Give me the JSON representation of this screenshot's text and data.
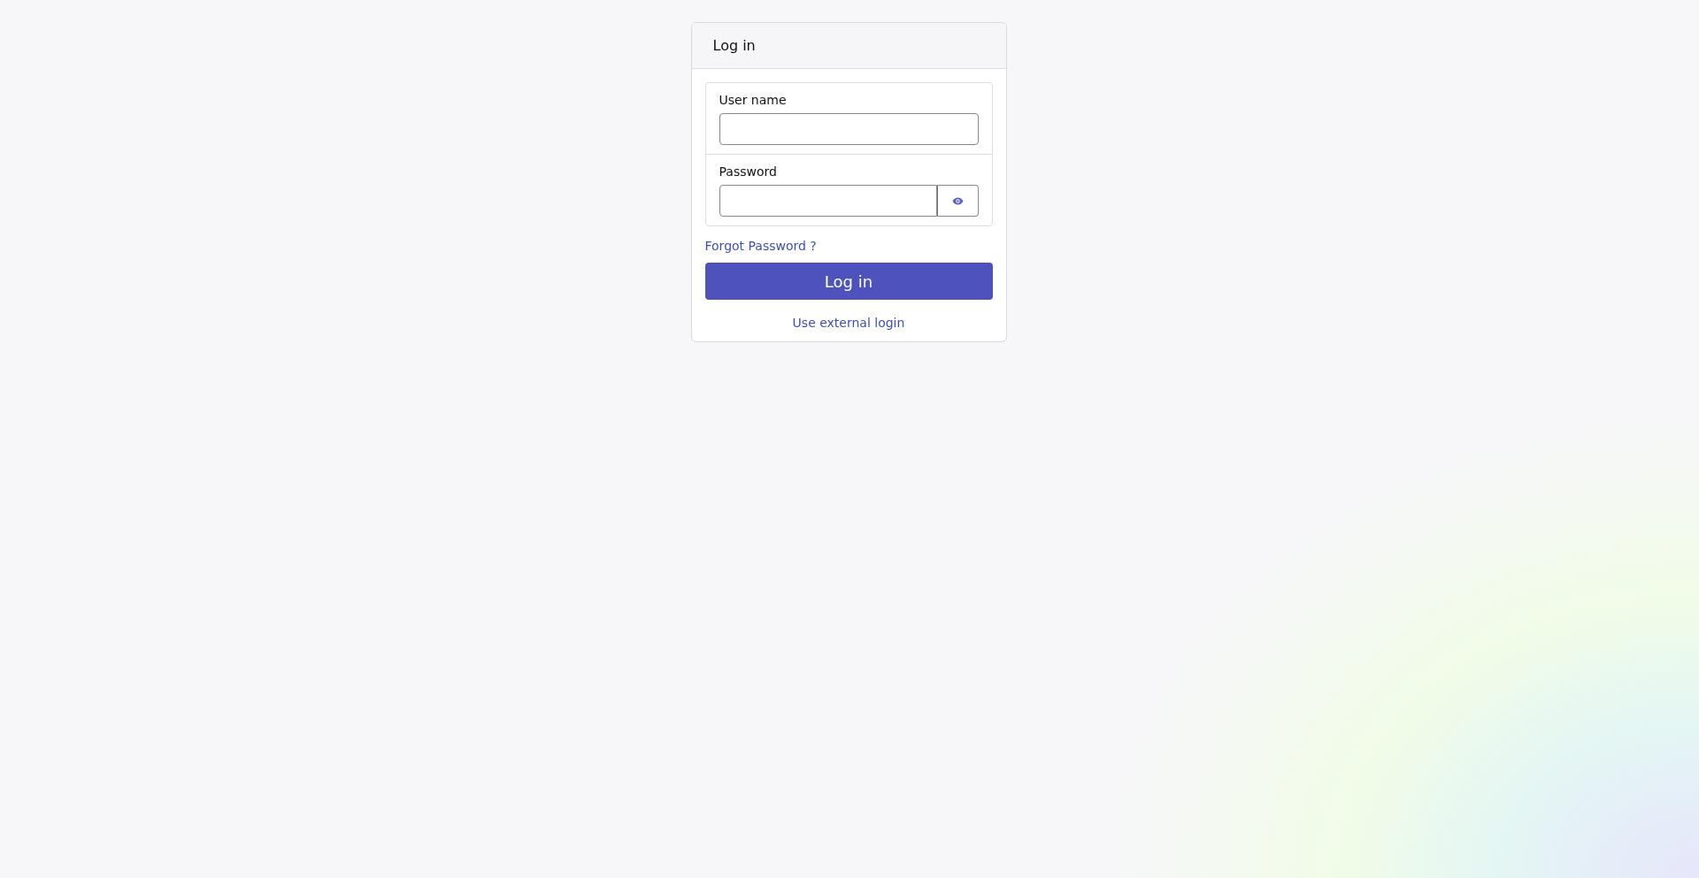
{
  "card": {
    "title": "Log in"
  },
  "fields": [
    {
      "kind": "text",
      "label": "User name"
    },
    {
      "kind": "password",
      "label": "Password"
    }
  ],
  "forgot_link": "Forgot Password ?",
  "submit_button": "Log in",
  "external_link": "Use external login"
}
